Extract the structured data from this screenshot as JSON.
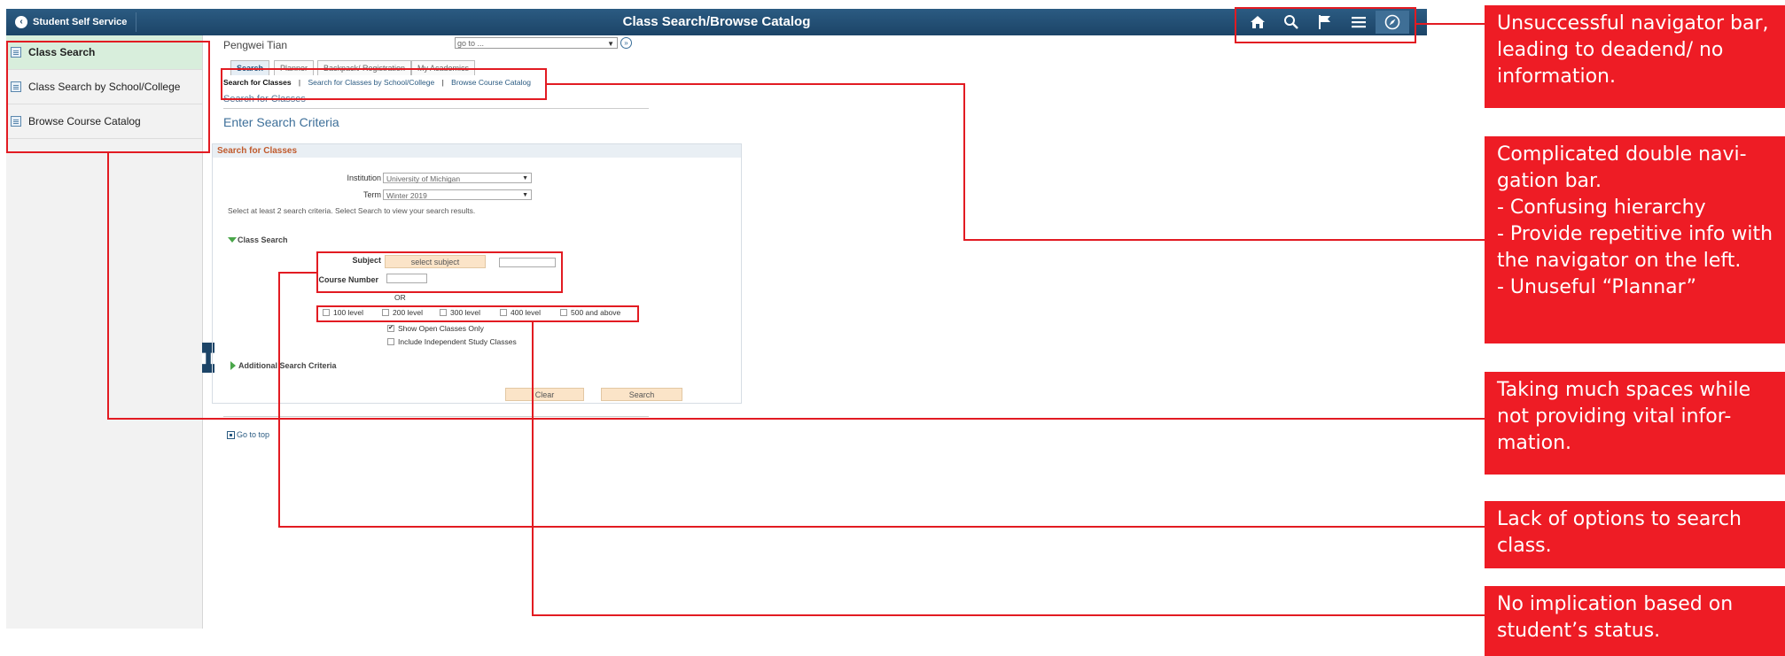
{
  "app": {
    "back_label": "Student Self Service",
    "title": "Class Search/Browse Catalog",
    "nav_icons": [
      "home-icon",
      "search-icon",
      "flag-icon",
      "menu-icon",
      "compass-icon"
    ]
  },
  "left_panel": {
    "items": [
      {
        "label": "Class Search",
        "active": true
      },
      {
        "label": "Class Search by School/College",
        "active": false
      },
      {
        "label": "Browse Course Catalog",
        "active": false
      }
    ]
  },
  "header": {
    "user": "Pengwei Tian",
    "goto_placeholder": "go to ..."
  },
  "tabs": [
    "Search",
    "Planner",
    "Backpack/ Registration",
    "My Academics"
  ],
  "subtabs": [
    "Search for Classes",
    "Search for Classes by School/College",
    "Browse Course Catalog"
  ],
  "breadcrumb": "Search for Classes",
  "page_title": "Enter Search Criteria",
  "search": {
    "section_title": "Search for Classes",
    "institution_label": "Institution",
    "institution_value": "University of Michigan",
    "term_label": "Term",
    "term_value": "Winter 2019",
    "hint": "Select at least 2 search criteria. Select Search to view your search results.",
    "class_search_label": "Class Search",
    "subject_label": "Subject",
    "subject_button": "select subject",
    "course_number_label": "Course Number",
    "or_label": "OR",
    "levels": [
      "100 level",
      "200 level",
      "300 level",
      "400 level",
      "500 and above"
    ],
    "open_only_label": "Show Open Classes Only",
    "independent_label": "Include Independent Study Classes",
    "additional_label": "Additional Search Criteria",
    "clear_button": "Clear",
    "search_button": "Search"
  },
  "go_top": "Go to top",
  "annotations": [
    "Unsuccessful navigator bar, leading to deadend/ no information.",
    "Complicated double navi-gation bar.\n- Confusing hierarchy\n- Provide repetitive info with the navigator on the left.\n- Unuseful “Plannar”",
    "Taking much spaces while not providing vital infor-mation.",
    "Lack of options to search class.",
    "No implication based on student’s status."
  ],
  "colors": {
    "topbar": "#1c4467",
    "annotation_red": "#ee1c25",
    "active_side": "#d8eedc",
    "button_peach": "#fbe4c8"
  }
}
